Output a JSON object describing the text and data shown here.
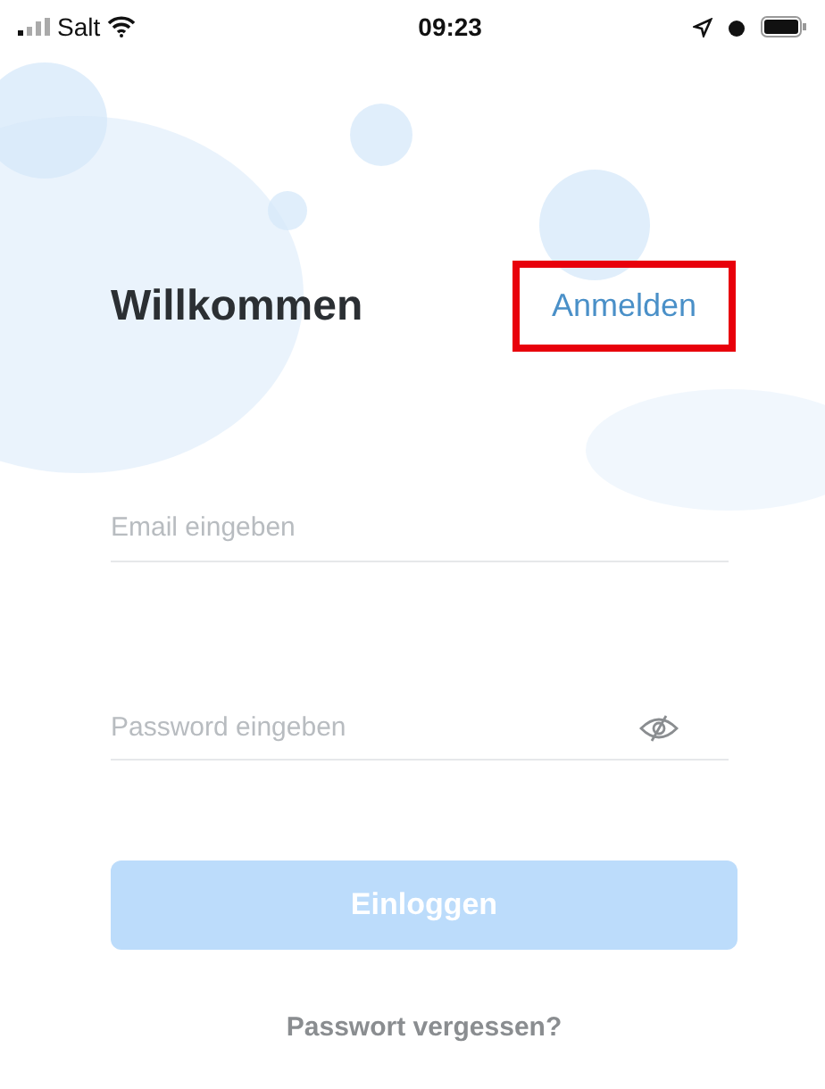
{
  "status_bar": {
    "carrier": "Salt",
    "time": "09:23"
  },
  "header": {
    "title": "Willkommen",
    "register_link": {
      "label": "Anmelden",
      "highlighted": true
    }
  },
  "fields": [
    {
      "kind": "email",
      "placeholder": "Email eingeben"
    },
    {
      "kind": "password",
      "placeholder": "Password eingeben"
    }
  ],
  "login_button": {
    "label": "Einloggen",
    "disabled": true
  },
  "forgot_link": "Passwort vergessen?"
}
